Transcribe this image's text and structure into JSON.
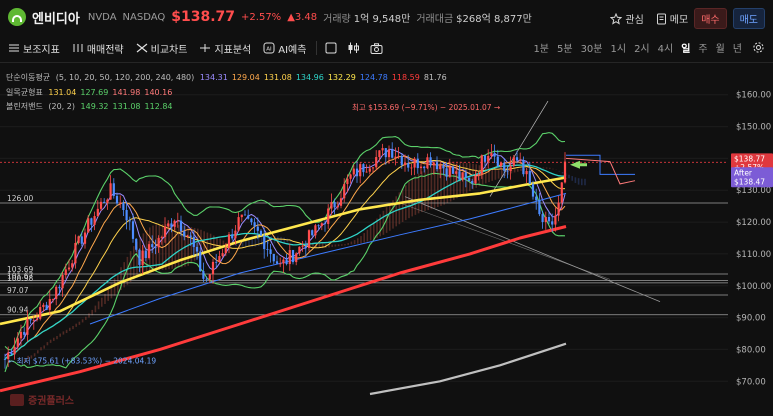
{
  "header": {
    "name": "엔비디아",
    "ticker": "NVDA",
    "exchange": "NASDAQ",
    "price": "$138.77",
    "change_pct": "+2.57%",
    "change_abs": "▲3.48",
    "volume_label": "거래량",
    "volume_value": "1억 9,548만",
    "turnover_label": "거래대금",
    "turnover_value": "$268억 8,877만",
    "watch_label": "관심",
    "memo_label": "메모",
    "buy_label": "매수",
    "sell_label": "매도"
  },
  "toolbar": {
    "indicators": "보조지표",
    "strategy": "매매전략",
    "compare": "비교차트",
    "analysis": "지표분석",
    "ai": "AI예측",
    "timeframes": [
      "1분",
      "5분",
      "30분",
      "1시",
      "2시",
      "4시",
      "일",
      "주",
      "월",
      "년"
    ],
    "active_timeframe": "일"
  },
  "legend": {
    "ma_label": "단순이동평균",
    "ma_params": "(5, 10, 20, 50, 120, 200, 240, 480)",
    "ma_values": [
      "134.31",
      "129.04",
      "131.08",
      "134.96",
      "132.29",
      "124.78",
      "118.59",
      "81.76"
    ],
    "ichimoku_label": "일목균형표",
    "ichimoku_values": [
      "131.04",
      "127.69",
      "141.98",
      "140.16"
    ],
    "bollinger_label": "볼린저밴드",
    "bollinger_params": "(20, 2)",
    "bollinger_values": [
      "149.32",
      "131.08",
      "112.84"
    ]
  },
  "colors": {
    "ma": [
      "#9b8cff",
      "#ffa94d",
      "#ffd24d",
      "#2fd4c8",
      "#ffe74d",
      "#3d7bff",
      "#ff3b3b",
      "#c0c0c0"
    ],
    "ichimoku": [
      "#ffd24d",
      "#5bd16a",
      "#ff7a7a",
      "#ff7a7a"
    ],
    "bollinger": [
      "#5bd16a",
      "#5bd16a",
      "#5bd16a"
    ],
    "up": "#ff4d4d",
    "down": "#4d8dff",
    "price_label_bg": "#e0383e",
    "after_label_bg": "#7c5cd6"
  },
  "chart_data": {
    "type": "candlestick",
    "title": "",
    "y_ticks": [
      "$160.00",
      "$150.00",
      "$140.00",
      "$130.00",
      "$120.00",
      "$110.00",
      "$100.00",
      "$90.00",
      "$80.00",
      "$70.00"
    ],
    "y_tick_values": [
      160,
      150,
      140,
      130,
      120,
      110,
      100,
      90,
      80,
      70
    ],
    "ylim": [
      66,
      164
    ],
    "price_label": "$138.77",
    "price_change_label": "+2.57%",
    "price_value": 138.77,
    "after_label": "After",
    "after_price": "$138.47",
    "after_value": 138.47,
    "high_annotation": "최고 $153.69 (−9.71%) − 2025.01.07 →",
    "low_annotation": "← 최저 $75.61 (+83.53%) − 2024.04.19",
    "levels": [
      {
        "label": "126.00",
        "value": 126.0
      },
      {
        "label": "103.69",
        "value": 103.7
      },
      {
        "label": "101.67",
        "value": 101.7
      },
      {
        "label": "100.98",
        "value": 100.9
      },
      {
        "label": "97.07",
        "value": 97.1
      },
      {
        "label": "90.94",
        "value": 90.9
      }
    ],
    "watermark": "증권플러스"
  }
}
